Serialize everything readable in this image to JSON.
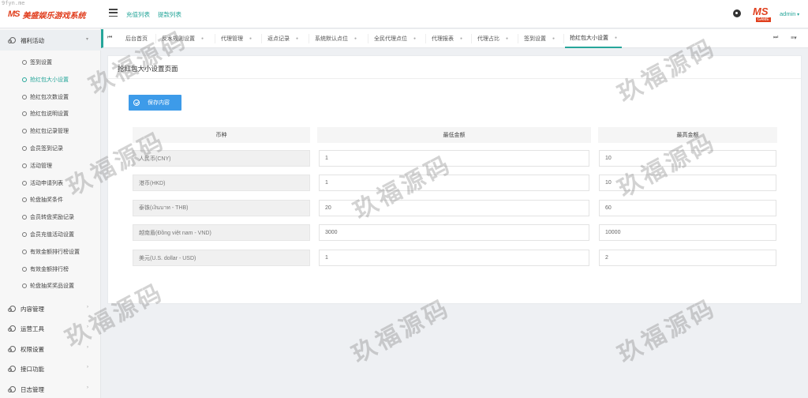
{
  "url_watermark": "9fyn.me",
  "app": {
    "logo_mark": "MS",
    "title": "美盛娱乐游戏系统"
  },
  "topnav": {
    "recharge": "充值列表",
    "withdraw": "提款列表"
  },
  "user": {
    "avatar_mark": "MS",
    "avatar_sub": "GAME",
    "name": "admin"
  },
  "sidebar": {
    "groups": [
      {
        "label": "福利活动",
        "expanded": true
      },
      {
        "label": "内容管理"
      },
      {
        "label": "运营工具"
      },
      {
        "label": "权限设置"
      },
      {
        "label": "接口功能"
      },
      {
        "label": "日志管理"
      }
    ],
    "items": [
      "签到设置",
      "抢红包大小设置",
      "抢红包次数设置",
      "抢红包说明设置",
      "抢红包记录管理",
      "会员签到记录",
      "活动管理",
      "活动申请列表",
      "轮盘抽奖条件",
      "会员转盘奖励记录",
      "会员充值活动设置",
      "有效金额排行榜设置",
      "有效金额排行榜",
      "轮盘抽奖奖品设置"
    ],
    "active_item": "抢红包大小设置"
  },
  "tabs": [
    "后台首页",
    "反水规则设置",
    "代理管理",
    "返点记录",
    "系统默认点位",
    "全民代理点位",
    "代理报表",
    "代理占比",
    "签到设置",
    "抢红包大小设置"
  ],
  "active_tab": "抢红包大小设置",
  "page": {
    "title": "抢红包大小设置页面",
    "save_label": "保存内容",
    "columns": [
      "币种",
      "最低金额",
      "最高金额"
    ],
    "rows": [
      {
        "currency": "人民币(CNY)",
        "min": "1",
        "max": "10"
      },
      {
        "currency": "港币(HKD)",
        "min": "1",
        "max": "10"
      },
      {
        "currency": "泰铢(เงินบาท - THB)",
        "min": "20",
        "max": "60"
      },
      {
        "currency": "越南盾(Đồng việt nam - VND)",
        "min": "3000",
        "max": "10000"
      },
      {
        "currency": "美元(U.S. dollar - USD)",
        "min": "1",
        "max": "2"
      }
    ]
  },
  "watermark_text": "玖福源码"
}
